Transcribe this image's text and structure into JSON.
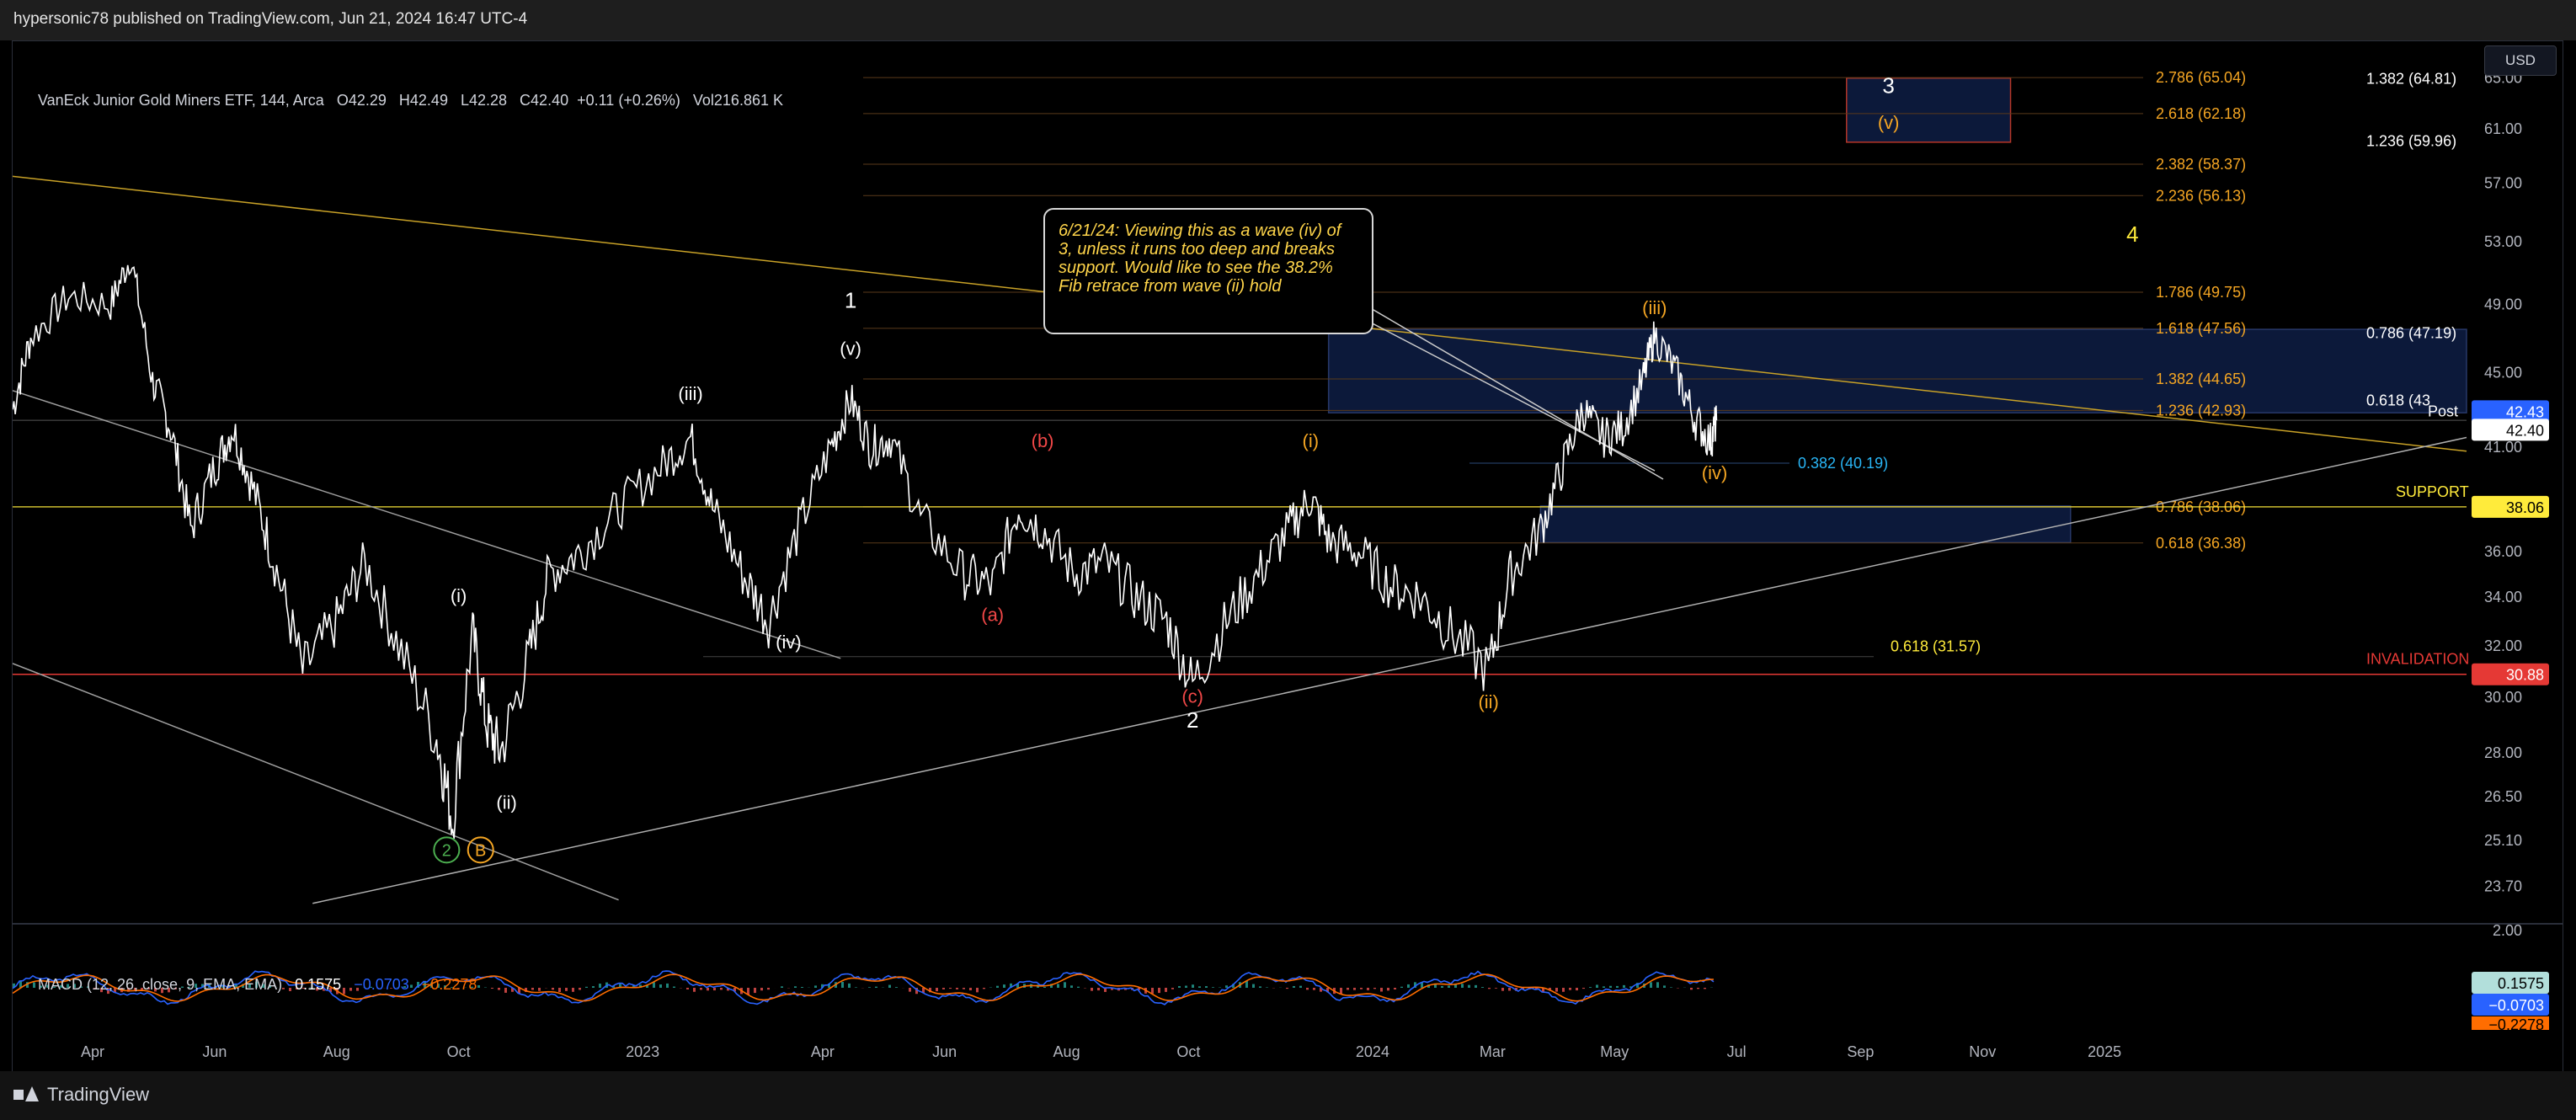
{
  "publisher": "hypersonic78 published on TradingView.com, Jun 21, 2024 16:47 UTC-4",
  "footer_brand": "TradingView",
  "currency_button": "USD",
  "symbol_legend": {
    "name": "VanEck Junior Gold Miners ETF, 144, Arca",
    "o_label": "O",
    "o": "42.29",
    "h_label": "H",
    "h": "42.49",
    "l_label": "L",
    "l": "42.28",
    "c_label": "C",
    "c": "42.40",
    "change": "+0.11 (+0.26%)",
    "vol_label": "Vol",
    "vol": "216.861 K"
  },
  "macd_legend": {
    "label": "MACD (12, 26, close, 9, EMA, EMA)",
    "v1": "0.1575",
    "v2": "−0.0703",
    "v3": "−0.2278"
  },
  "note": "6/21/24: Viewing this as a wave (iv) of 3, unless it runs too deep and breaks support.  Would like to see the 38.2% Fib retrace from wave (ii) hold",
  "chart_data": {
    "type": "line",
    "title": "VanEck Junior Gold Miners ETF, 144, Arca",
    "ylim": [
      23.0,
      66.5
    ],
    "xlim": [
      "2022-02-20",
      "2025-07-01"
    ],
    "y_ticks": [
      "65.00",
      "61.00",
      "57.00",
      "53.00",
      "49.00",
      "45.00",
      "41.00",
      "38.00",
      "36.00",
      "34.00",
      "32.00",
      "30.00",
      "28.00",
      "26.50",
      "25.10",
      "23.70"
    ],
    "macd_ticks": [
      "2.00"
    ],
    "x_ticks": [
      {
        "label": "Apr",
        "date": "2022-04-01"
      },
      {
        "label": "Jun",
        "date": "2022-06-01"
      },
      {
        "label": "Aug",
        "date": "2022-08-01"
      },
      {
        "label": "Oct",
        "date": "2022-10-01"
      },
      {
        "label": "2023",
        "date": "2023-01-01"
      },
      {
        "label": "Apr",
        "date": "2023-04-01"
      },
      {
        "label": "Jun",
        "date": "2023-06-01"
      },
      {
        "label": "Aug",
        "date": "2023-08-01"
      },
      {
        "label": "Oct",
        "date": "2023-10-01"
      },
      {
        "label": "2024",
        "date": "2024-01-01"
      },
      {
        "label": "Mar",
        "date": "2024-03-01"
      },
      {
        "label": "May",
        "date": "2024-05-01"
      },
      {
        "label": "Jul",
        "date": "2024-07-01"
      },
      {
        "label": "Sep",
        "date": "2024-09-01"
      },
      {
        "label": "Nov",
        "date": "2024-11-01"
      },
      {
        "label": "2025",
        "date": "2025-01-01"
      }
    ],
    "price_path": [
      [
        "2022-02-20",
        43.0
      ],
      [
        "2022-03-01",
        47.0
      ],
      [
        "2022-03-20",
        49.5
      ],
      [
        "2022-04-10",
        49.0
      ],
      [
        "2022-04-20",
        52.0
      ],
      [
        "2022-05-01",
        44.5
      ],
      [
        "2022-05-10",
        42.0
      ],
      [
        "2022-05-20",
        37.0
      ],
      [
        "2022-06-01",
        40.0
      ],
      [
        "2022-06-10",
        42.0
      ],
      [
        "2022-06-20",
        39.0
      ],
      [
        "2022-07-01",
        35.5
      ],
      [
        "2022-07-15",
        31.0
      ],
      [
        "2022-08-01",
        33.0
      ],
      [
        "2022-08-15",
        35.5
      ],
      [
        "2022-09-01",
        32.0
      ],
      [
        "2022-09-20",
        28.5
      ],
      [
        "2022-09-28",
        25.7
      ],
      [
        "2022-10-08",
        32.5
      ],
      [
        "2022-10-15",
        29.0
      ],
      [
        "2022-10-22",
        28.0
      ],
      [
        "2022-11-05",
        31.5
      ],
      [
        "2022-11-15",
        35.0
      ],
      [
        "2022-12-01",
        36.0
      ],
      [
        "2022-12-20",
        38.0
      ],
      [
        "2023-01-10",
        40.0
      ],
      [
        "2023-01-25",
        41.5
      ],
      [
        "2023-02-05",
        38.0
      ],
      [
        "2023-02-20",
        35.0
      ],
      [
        "2023-03-05",
        33.0
      ],
      [
        "2023-03-20",
        37.0
      ],
      [
        "2023-04-05",
        41.0
      ],
      [
        "2023-04-15",
        43.5
      ],
      [
        "2023-04-25",
        41.0
      ],
      [
        "2023-05-05",
        41.5
      ],
      [
        "2023-05-20",
        37.5
      ],
      [
        "2023-06-10",
        35.0
      ],
      [
        "2023-06-25",
        34.5
      ],
      [
        "2023-07-08",
        38.0
      ],
      [
        "2023-07-20",
        37.0
      ],
      [
        "2023-08-05",
        35.0
      ],
      [
        "2023-08-20",
        35.5
      ],
      [
        "2023-09-05",
        34.0
      ],
      [
        "2023-09-20",
        33.0
      ],
      [
        "2023-10-03",
        30.5
      ],
      [
        "2023-10-20",
        33.0
      ],
      [
        "2023-11-05",
        35.0
      ],
      [
        "2023-11-20",
        37.0
      ],
      [
        "2023-12-01",
        38.5
      ],
      [
        "2023-12-10",
        36.5
      ],
      [
        "2023-12-25",
        36.0
      ],
      [
        "2024-01-10",
        34.5
      ],
      [
        "2024-01-25",
        34.0
      ],
      [
        "2024-02-10",
        32.5
      ],
      [
        "2024-02-28",
        31.0
      ],
      [
        "2024-03-10",
        35.0
      ],
      [
        "2024-03-25",
        37.0
      ],
      [
        "2024-04-05",
        40.0
      ],
      [
        "2024-04-15",
        43.0
      ],
      [
        "2024-04-25",
        41.5
      ],
      [
        "2024-05-05",
        42.0
      ],
      [
        "2024-05-15",
        44.5
      ],
      [
        "2024-05-21",
        47.2
      ],
      [
        "2024-06-01",
        45.0
      ],
      [
        "2024-06-10",
        42.5
      ],
      [
        "2024-06-18",
        41.3
      ],
      [
        "2024-06-21",
        42.4
      ]
    ],
    "fib_levels": [
      {
        "label": "2.786 (65.04)",
        "value": 65.04,
        "color": "#f5a623"
      },
      {
        "label": "2.618 (62.18)",
        "value": 62.18,
        "color": "#f5a623"
      },
      {
        "label": "2.382 (58.37)",
        "value": 58.37,
        "color": "#f5a623"
      },
      {
        "label": "2.236 (56.13)",
        "value": 56.13,
        "color": "#f5a623"
      },
      {
        "label": "1.786 (49.75)",
        "value": 49.75,
        "color": "#f5a623"
      },
      {
        "label": "1.618 (47.56)",
        "value": 47.56,
        "color": "#f5a623"
      },
      {
        "label": "1.382 (44.65)",
        "value": 44.65,
        "color": "#f5a623"
      },
      {
        "label": "1.236 (42.93)",
        "value": 42.93,
        "color": "#f5a623"
      },
      {
        "label": "0.786 (38.06)",
        "value": 38.06,
        "color": "#f5a623"
      },
      {
        "label": "0.618 (36.38)",
        "value": 36.38,
        "color": "#f5a623"
      }
    ],
    "fib_white": [
      {
        "label": "1.382 (64.81)",
        "value": 64.81
      },
      {
        "label": "1.236 (59.96)",
        "value": 59.96
      },
      {
        "label": "0.786 (47.19)",
        "value": 47.19
      },
      {
        "label": "0.618 (43",
        "value": 43.38
      }
    ],
    "fib_blue": {
      "label": "0.382 (40.19)",
      "value": 40.19
    },
    "fib_yellow": {
      "label": "0.618 (31.57)",
      "value": 31.57
    },
    "support": {
      "label": "SUPPORT",
      "value": 38.06,
      "tag": "38.06"
    },
    "invalidation": {
      "label": "INVALIDATION",
      "value": 30.88,
      "tag": "30.88"
    },
    "post_tag": {
      "label": "Post",
      "value": "42.43"
    },
    "last_tag": "42.40",
    "wave_labels": [
      {
        "text": "(i)",
        "date": "2022-10-01",
        "value": 33.8,
        "color": "#ffffff"
      },
      {
        "text": "(ii)",
        "date": "2022-10-25",
        "value": 26.1,
        "color": "#ffffff"
      },
      {
        "text": "(iii)",
        "date": "2023-01-25",
        "value": 43.5,
        "color": "#ffffff"
      },
      {
        "text": "(iv)",
        "date": "2023-03-15",
        "value": 31.9,
        "color": "#ffffff"
      },
      {
        "text": "(v)",
        "date": "2023-04-15",
        "value": 46.0,
        "color": "#ffffff"
      },
      {
        "text": "1",
        "date": "2023-04-15",
        "value": 48.8,
        "color": "#ffffff"
      },
      {
        "text": "(a)",
        "date": "2023-06-25",
        "value": 33.0,
        "color": "#f04747"
      },
      {
        "text": "(b)",
        "date": "2023-07-20",
        "value": 41.0,
        "color": "#f04747"
      },
      {
        "text": "(c)",
        "date": "2023-10-03",
        "value": 29.8,
        "color": "#f04747"
      },
      {
        "text": "2",
        "date": "2023-10-03",
        "value": 28.9,
        "color": "#ffffff"
      },
      {
        "text": "(i)",
        "date": "2023-12-01",
        "value": 41.0,
        "color": "#f5a623"
      },
      {
        "text": "(ii)",
        "date": "2024-02-28",
        "value": 29.6,
        "color": "#f5a623"
      },
      {
        "text": "(iii)",
        "date": "2024-05-21",
        "value": 48.4,
        "color": "#f5a623"
      },
      {
        "text": "(iv)",
        "date": "2024-06-20",
        "value": 39.4,
        "color": "#f5a623"
      },
      {
        "text": "3",
        "date": "2024-09-15",
        "value": 63.8,
        "color": "#ffffff"
      },
      {
        "text": "(v)",
        "date": "2024-09-15",
        "value": 61.0,
        "color": "#f5a623"
      },
      {
        "text": "4",
        "date": "2025-01-15",
        "value": 53.0,
        "color": "#ffeb3b"
      }
    ],
    "circled_labels": [
      {
        "text": "2",
        "date": "2022-09-25",
        "value": 24.8,
        "color": "#4caf50"
      },
      {
        "text": "B",
        "date": "2022-10-12",
        "value": 24.8,
        "color": "#f5a623"
      }
    ],
    "trendlines": [
      {
        "from": [
          "2022-02-20",
          57.5
        ],
        "to": [
          "2025-07-01",
          40.8
        ],
        "color": "#c9a227"
      },
      {
        "from": [
          "2022-02-20",
          44.0
        ],
        "to": [
          "2023-04-10",
          31.5
        ],
        "color": "#9e9e9e"
      },
      {
        "from": [
          "2022-02-20",
          31.3
        ],
        "to": [
          "2022-12-20",
          23.3
        ],
        "color": "#9e9e9e"
      },
      {
        "from": [
          "2022-07-20",
          23.2
        ],
        "to": [
          "2025-07-01",
          41.5
        ],
        "color": "#b0b0b0"
      }
    ],
    "zones": [
      {
        "from": [
          "2023-12-10",
          47.5
        ],
        "to": [
          "2025-07-01",
          42.8
        ]
      },
      {
        "from": [
          "2024-03-25",
          38.1
        ],
        "to": [
          "2024-12-15",
          36.4
        ]
      },
      {
        "from": [
          "2024-08-25",
          65.0
        ],
        "to": [
          "2024-11-15",
          60.0
        ]
      }
    ]
  }
}
